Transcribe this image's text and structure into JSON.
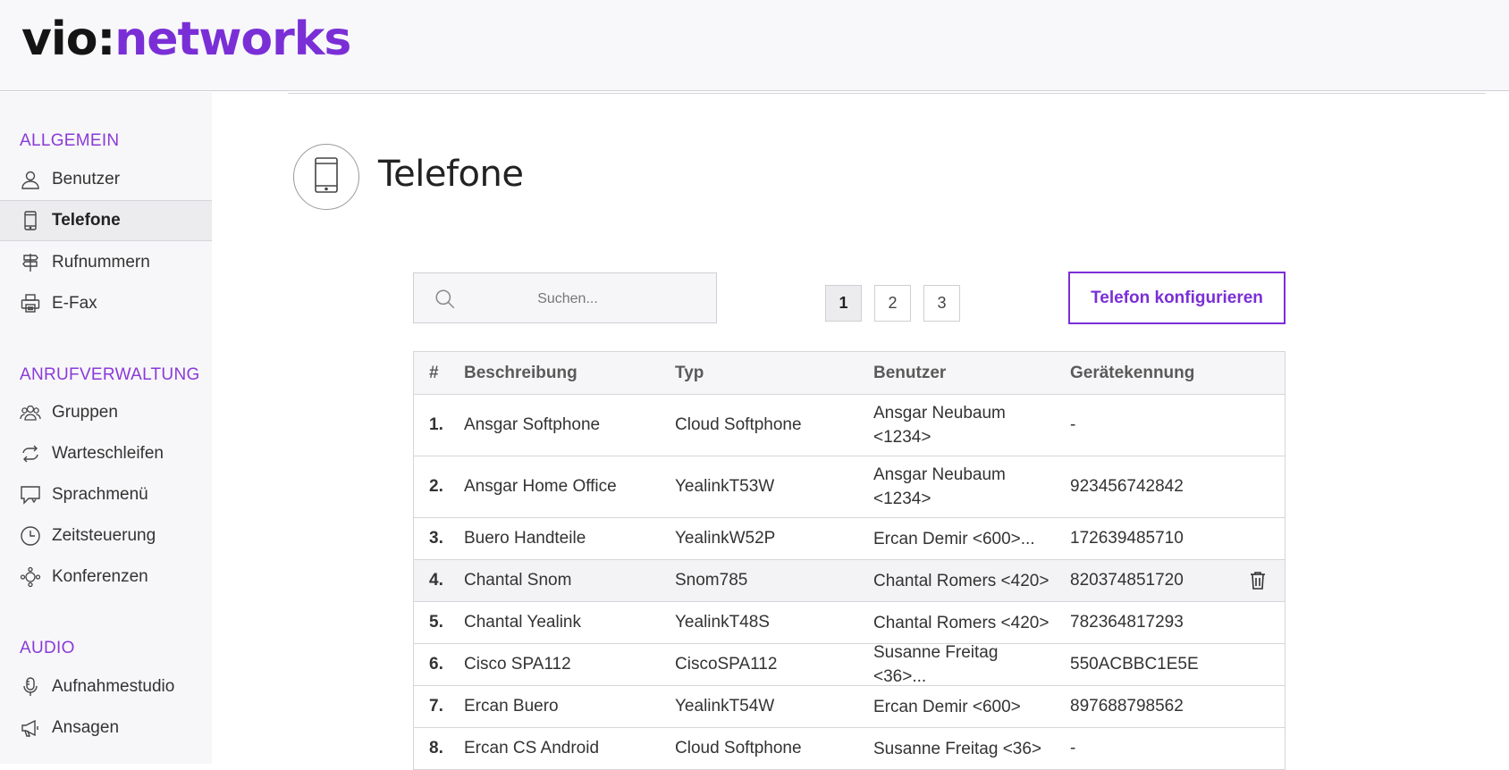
{
  "brand": {
    "part1": "vio:",
    "part2": "networks"
  },
  "sidebar": {
    "sections": [
      {
        "label": "ALLGEMEIN"
      },
      {
        "label": "ANRUFVERWALTUNG"
      },
      {
        "label": "AUDIO"
      }
    ],
    "items": [
      {
        "label": "Benutzer",
        "icon": "user-icon"
      },
      {
        "label": "Telefone",
        "icon": "phone-icon",
        "active": true
      },
      {
        "label": "Rufnummern",
        "icon": "signpost-icon"
      },
      {
        "label": "E-Fax",
        "icon": "printer-icon"
      },
      {
        "label": "Gruppen",
        "icon": "group-icon"
      },
      {
        "label": "Warteschleifen",
        "icon": "loop-icon"
      },
      {
        "label": "Sprachmenü",
        "icon": "speech-menu-icon"
      },
      {
        "label": "Zeitsteuerung",
        "icon": "clock-icon"
      },
      {
        "label": "Konferenzen",
        "icon": "conference-icon"
      },
      {
        "label": "Aufnahmestudio",
        "icon": "microphone-icon"
      },
      {
        "label": "Ansagen",
        "icon": "megaphone-icon"
      }
    ]
  },
  "page": {
    "title": "Telefone",
    "icon": "phone-icon"
  },
  "search": {
    "placeholder": "Suchen..."
  },
  "pagination": {
    "pages": [
      "1",
      "2",
      "3"
    ],
    "current": "1"
  },
  "configure_button": {
    "label": "Telefon konfigurieren"
  },
  "table": {
    "headers": {
      "num": "#",
      "desc": "Beschreibung",
      "typ": "Typ",
      "ben": "Benutzer",
      "ger": "Gerätekennung"
    },
    "rows": [
      {
        "num": "1.",
        "desc": "Ansgar Softphone",
        "typ": "Cloud Softphone",
        "ben": "Ansgar Neubaum <1234>",
        "ger": "-"
      },
      {
        "num": "2.",
        "desc": "Ansgar Home Office",
        "typ": "YealinkT53W",
        "ben": "Ansgar Neubaum <1234>",
        "ger": "923456742842"
      },
      {
        "num": "3.",
        "desc": "Buero Handteile",
        "typ": "YealinkW52P",
        "ben": "Ercan Demir <600>...",
        "ger": "172639485710"
      },
      {
        "num": "4.",
        "desc": "Chantal Snom",
        "typ": "Snom785",
        "ben": "Chantal Romers <420>",
        "ger": "820374851720"
      },
      {
        "num": "5.",
        "desc": "Chantal Yealink",
        "typ": "YealinkT48S",
        "ben": "Chantal Romers <420>",
        "ger": "782364817293"
      },
      {
        "num": "6.",
        "desc": "Cisco SPA112",
        "typ": "CiscoSPA112",
        "ben": "Susanne Freitag <36>...",
        "ger": "550ACBBC1E5E"
      },
      {
        "num": "7.",
        "desc": "Ercan Buero",
        "typ": "YealinkT54W",
        "ben": "Ercan Demir <600>",
        "ger": "897688798562"
      },
      {
        "num": "8.",
        "desc": "Ercan CS Android",
        "typ": "Cloud Softphone",
        "ben": "Susanne Freitag <36>",
        "ger": "-"
      }
    ]
  },
  "colors": {
    "accent": "#7a2fd6",
    "sidebar_bg": "#f7f7f9",
    "border": "#d6d6da"
  }
}
